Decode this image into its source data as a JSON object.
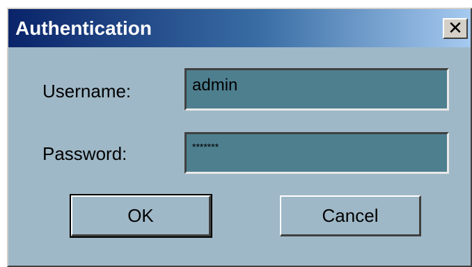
{
  "window": {
    "title": "Authentication",
    "close_symbol": "✕"
  },
  "form": {
    "username_label": "Username:",
    "username_value": "admin",
    "password_label": "Password:",
    "password_value": "*******"
  },
  "buttons": {
    "ok_label": "OK",
    "cancel_label": "Cancel"
  },
  "colors": {
    "titlebar_start": "#0a246a",
    "titlebar_end": "#a6caf0",
    "dialog_background": "#9fb8c7",
    "field_background": "#4e7f8f"
  },
  "icons": {
    "close": "close-icon"
  }
}
